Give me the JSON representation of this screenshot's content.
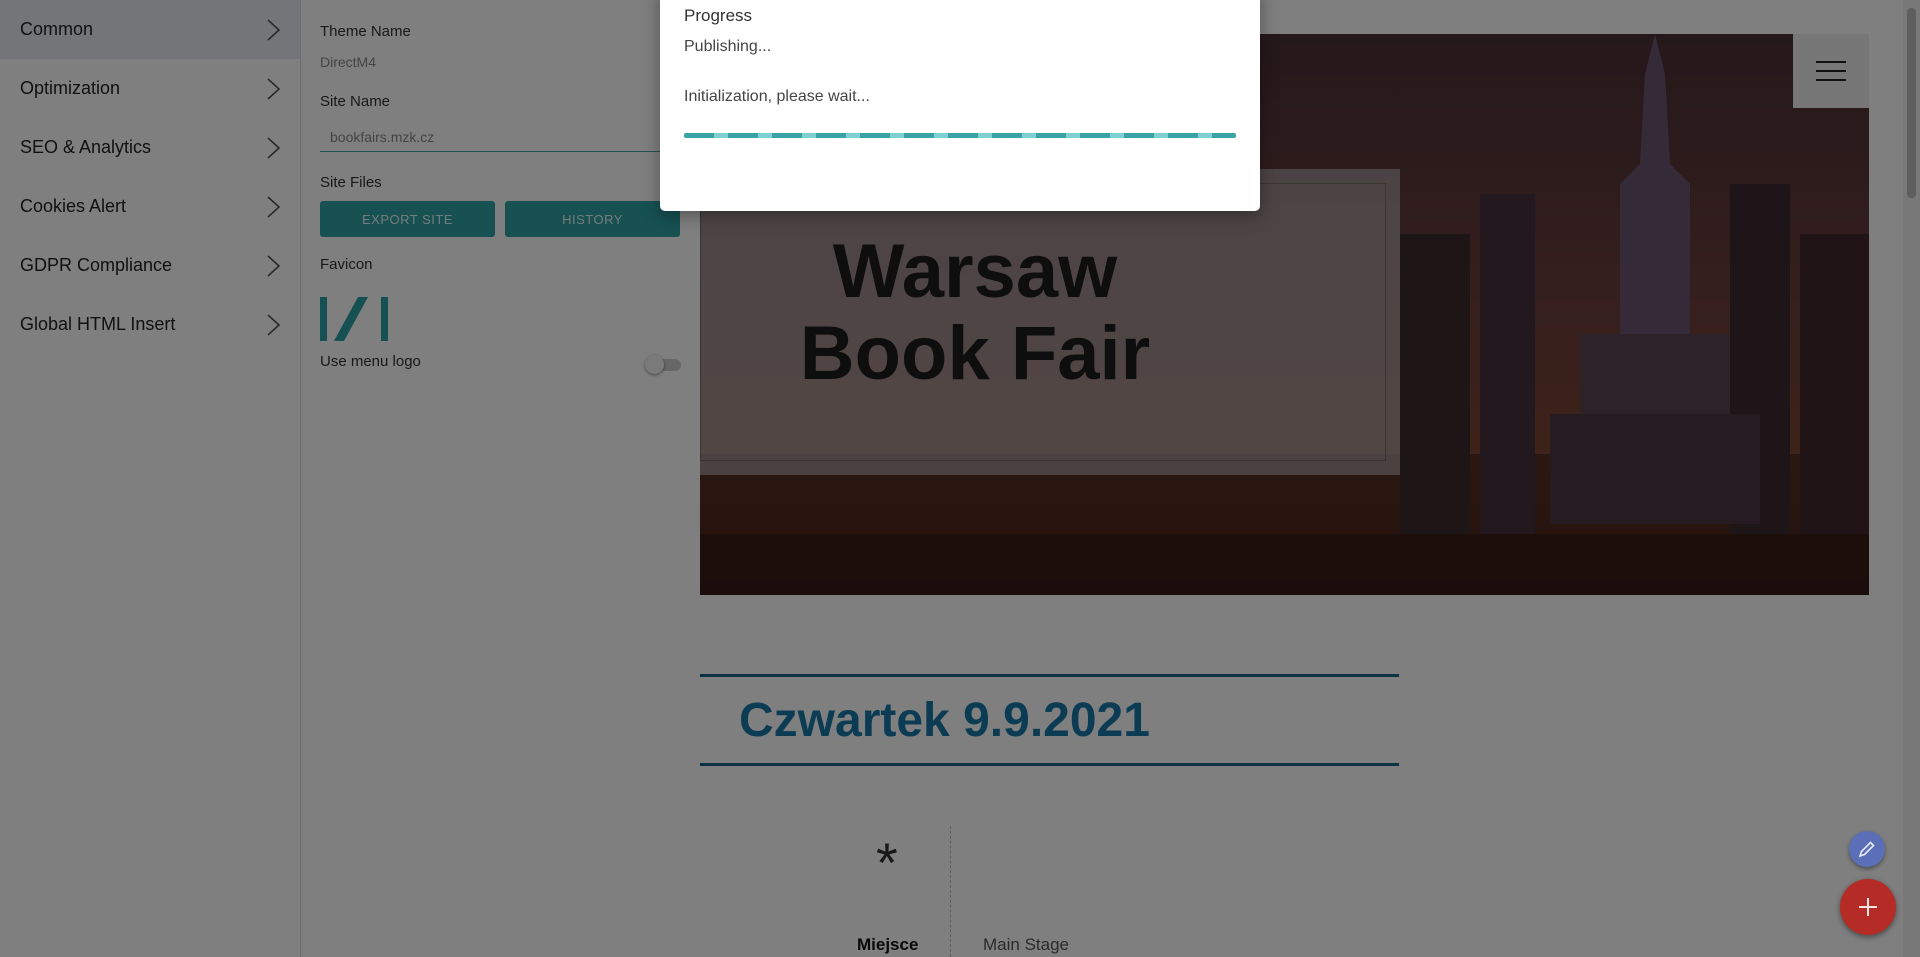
{
  "menu": {
    "items": [
      {
        "label": "Common",
        "active": true
      },
      {
        "label": "Optimization"
      },
      {
        "label": "SEO & Analytics"
      },
      {
        "label": "Cookies Alert"
      },
      {
        "label": "GDPR Compliance"
      },
      {
        "label": "Global HTML Insert"
      }
    ],
    "chevron_icon": "chevron-right-icon"
  },
  "panel": {
    "theme_name_label": "Theme Name",
    "theme_name_value": "DirectM4",
    "site_name_label": "Site Name",
    "site_name_value": "bookfairs.mzk.cz",
    "site_files_label": "Site Files",
    "export_button": "EXPORT SITE",
    "history_button": "HISTORY",
    "favicon_label": "Favicon",
    "use_menu_logo_label": "Use menu logo",
    "use_menu_logo_on": false
  },
  "preview": {
    "hero_title_line1": "Warsaw",
    "hero_title_line2": "Book Fair",
    "day_heading": "Czwartek 9.9.2021",
    "star_symbol": "*",
    "place_label": "Miejsce",
    "place_value": "Main Stage"
  },
  "modal": {
    "title": "Progress",
    "status": "Publishing...",
    "message": "Initialization, please wait...",
    "progress_percent": 100
  },
  "colors": {
    "accent_teal": "#2fa3a5",
    "heading_blue": "#1678a8",
    "fab_add": "#b52b26",
    "fab_edit": "#5a6fb8"
  },
  "icons": {
    "menu": "hamburger-icon",
    "edit": "pencil-icon",
    "add": "plus-icon"
  }
}
